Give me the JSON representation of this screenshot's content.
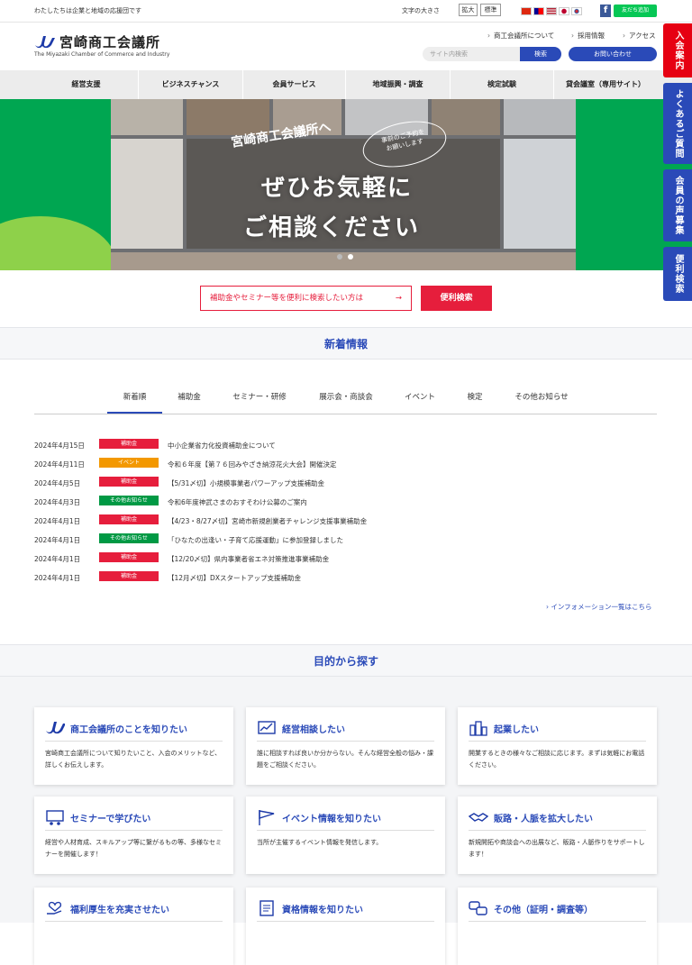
{
  "topbar": {
    "tagline": "わたしたちは企業と地域の応援団です",
    "fontsize_label": "文字の大きさ",
    "enlarge": "拡大",
    "standard": "標準",
    "line_label": "友だち追加"
  },
  "header": {
    "logo_title": "宮崎商工会議所",
    "logo_sub": "The Miyazaki Chamber of Commerce and Industry",
    "links": [
      "商工会議所について",
      "採用情報",
      "アクセス"
    ],
    "search_placeholder": "サイト内検索",
    "search_button": "検索",
    "contact_button": "お問い合わせ"
  },
  "nav": [
    "経営支援",
    "ビジネスチャンス",
    "会員サービス",
    "地域振興・調査",
    "検定試験",
    "貸会議室（専用サイト）"
  ],
  "side_tabs": [
    {
      "label": "入会案内",
      "color": "#e60012"
    },
    {
      "label": "よくあるご質問",
      "color": "#2a4ab8"
    },
    {
      "label": "会員の声募集",
      "color": "#2a4ab8"
    },
    {
      "label": "便利検索",
      "color": "#2a4ab8"
    }
  ],
  "hero": {
    "sub": "宮崎商工会議所へ",
    "bubble": "事前のご予約を\nお願いします",
    "line1": "ぜひお気軽に",
    "line2": "ご相談ください"
  },
  "quick": {
    "help_text": "補助金やセミナー等を便利に検索したい方は",
    "arrow": "→",
    "button": "便利検索"
  },
  "news_section": {
    "heading": "新着情報",
    "tabs": [
      "新着順",
      "補助金",
      "セミナー・研修",
      "展示会・商談会",
      "イベント",
      "検定",
      "その他お知らせ"
    ],
    "items": [
      {
        "date": "2024年4月15日",
        "badge": "補助金",
        "badge_color": "#e61e3c",
        "title": "中小企業省力化投資補助金について"
      },
      {
        "date": "2024年4月11日",
        "badge": "イベント",
        "badge_color": "#f39800",
        "title": "令和６年度【第７６回みやざき納涼花火大会】開催決定"
      },
      {
        "date": "2024年4月5日",
        "badge": "補助金",
        "badge_color": "#e61e3c",
        "title": "【5/31〆切】小規模事業者パワーアップ支援補助金"
      },
      {
        "date": "2024年4月3日",
        "badge": "その他お知らせ",
        "badge_color": "#009944",
        "title": "令和6年度神武さまのおすそわけ公募のご案内"
      },
      {
        "date": "2024年4月1日",
        "badge": "補助金",
        "badge_color": "#e61e3c",
        "title": "【4/23・8/27〆切】宮崎市新規創業者チャレンジ支援事業補助金"
      },
      {
        "date": "2024年4月1日",
        "badge": "その他お知らせ",
        "badge_color": "#009944",
        "title": "「ひなたの出逢い・子育て応援運動」に参加登録しました"
      },
      {
        "date": "2024年4月1日",
        "badge": "補助金",
        "badge_color": "#e61e3c",
        "title": "【12/20〆切】県内事業者省エネ対策推進事業補助金"
      },
      {
        "date": "2024年4月1日",
        "badge": "補助金",
        "badge_color": "#e61e3c",
        "title": "【12月〆切】DXスタートアップ支援補助金"
      }
    ],
    "more_link": "インフォメーション一覧はこちら"
  },
  "purpose_section": {
    "heading": "目的から探す",
    "cards": [
      {
        "title": "商工会議所のことを知りたい",
        "icon": "logo-icon",
        "desc": "宮崎商工会議所について知りたいこと、入会のメリットなど、詳しくお伝えします。"
      },
      {
        "title": "経営相談したい",
        "icon": "chart-icon",
        "desc": "誰に相談すれば良いか分からない。そんな経営全般の悩み・課題をご相談ください。"
      },
      {
        "title": "起業したい",
        "icon": "city-icon",
        "desc": "開業するときの様々なご相談に応じます。まずは気軽にお電話ください。"
      },
      {
        "title": "セミナーで学びたい",
        "icon": "presentation-icon",
        "desc": "経営や人材育成、スキルアップ等に繋がるもの等、多様なセミナーを開催します！"
      },
      {
        "title": "イベント情報を知りたい",
        "icon": "flag-icon",
        "desc": "当所が主催するイベント情報を発信します。"
      },
      {
        "title": "販路・人脈を拡大したい",
        "icon": "handshake-icon",
        "desc": "新規開拓や商談会への出展など、販路・人脈作りをサポートします！"
      },
      {
        "title": "福利厚生を充実させたい",
        "icon": "heart-hand-icon",
        "desc": ""
      },
      {
        "title": "資格情報を知りたい",
        "icon": "document-icon",
        "desc": ""
      },
      {
        "title": "その他（証明・調査等）",
        "icon": "chat-icon",
        "desc": ""
      }
    ]
  }
}
